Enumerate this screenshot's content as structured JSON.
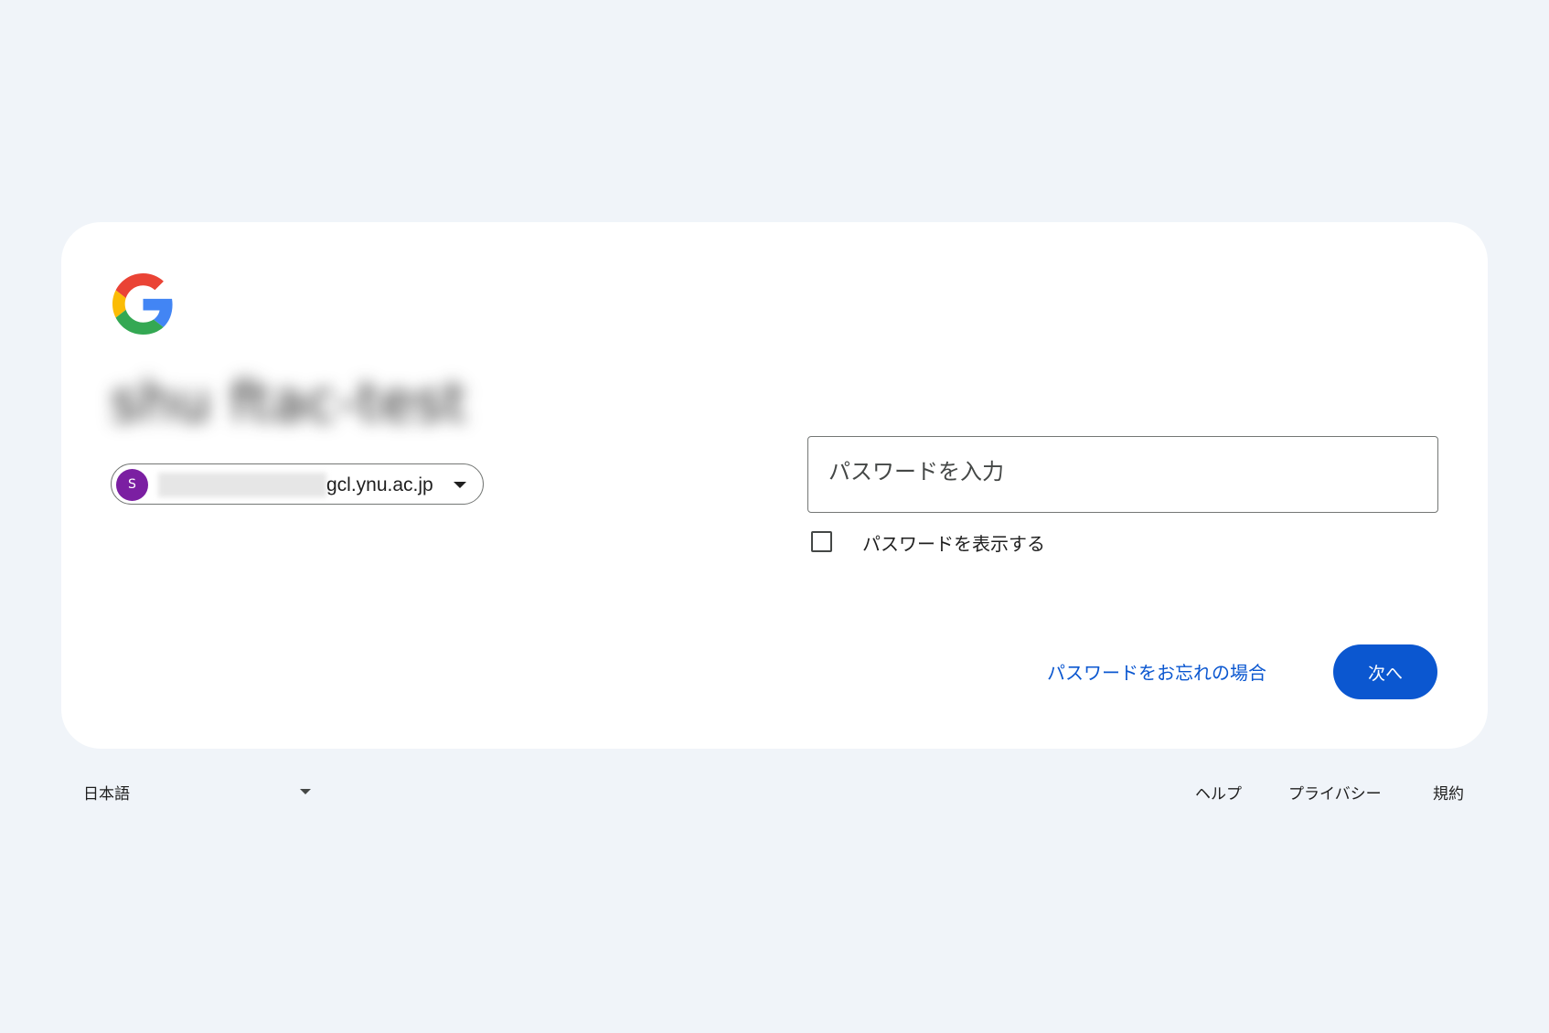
{
  "card": {
    "logo_icon": "google-g-icon",
    "title": "shu ftac-test",
    "account": {
      "avatar_letter": "S",
      "avatar_color": "#7b1fa2",
      "email_domain": "gcl.ynu.ac.jp",
      "caret_icon": "caret-down-icon"
    },
    "password": {
      "placeholder": "パスワードを入力",
      "value": ""
    },
    "show_password": {
      "label": "パスワードを表示する",
      "checked": false
    },
    "forgot_password_label": "パスワードをお忘れの場合",
    "next_button_label": "次へ"
  },
  "footer": {
    "language": "日本語",
    "links": {
      "help": "ヘルプ",
      "privacy": "プライバシー",
      "terms": "規約"
    }
  },
  "colors": {
    "background": "#f0f4f9",
    "card": "#ffffff",
    "primary": "#0b57d0",
    "text": "#1f1f1f"
  }
}
